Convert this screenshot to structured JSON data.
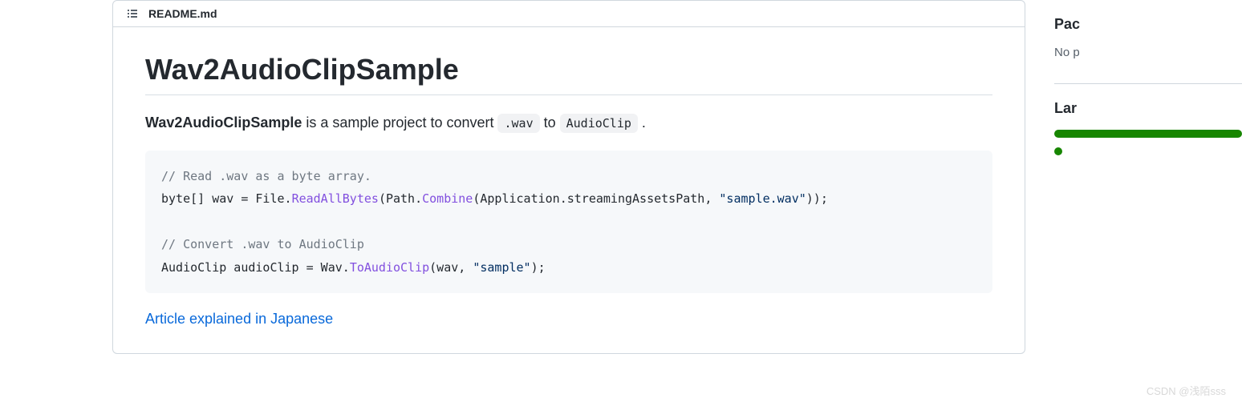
{
  "readme": {
    "filename": "README.md",
    "title": "Wav2AudioClipSample",
    "desc_strong": "Wav2AudioClipSample",
    "desc_mid1": " is a sample project to convert ",
    "desc_code1": ".wav",
    "desc_mid2": " to ",
    "desc_code2": "AudioClip",
    "desc_end": " .",
    "code": {
      "c1": "// Read .wav as a byte array.",
      "l2a": "byte[] wav = File.",
      "l2b": "ReadAllBytes",
      "l2c": "(Path.",
      "l2d": "Combine",
      "l2e": "(Application.streamingAssetsPath, ",
      "l2f": "\"sample.wav\"",
      "l2g": "));",
      "c2": "// Convert .wav to AudioClip",
      "l4a": "AudioClip audioClip = Wav.",
      "l4b": "ToAudioClip",
      "l4c": "(wav, ",
      "l4d": "\"sample\"",
      "l4e": ");"
    },
    "link_text": "Article explained in Japanese"
  },
  "sidebar": {
    "packages_heading": "Pac",
    "packages_text": "No p",
    "languages_heading": "Lar"
  },
  "watermark": "CSDN @浅陌sss"
}
